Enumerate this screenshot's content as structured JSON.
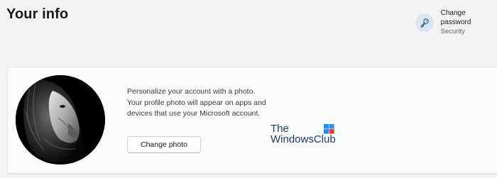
{
  "page": {
    "title": "Your info"
  },
  "related": {
    "title": "Change password",
    "subtitle": "Security",
    "icon": "key-icon"
  },
  "photo_card": {
    "avatar_icon": "lion-photo",
    "description": "Personalize your account with a photo. Your profile photo will appear on apps and devices that use your Microsoft account.",
    "button_label": "Change photo"
  },
  "watermark": {
    "line1": "The",
    "line2": "WindowsClub",
    "logo_colors": [
      "#1e90ff",
      "#e53935"
    ]
  },
  "colors": {
    "background": "#f3f3f3",
    "card": "#fbfbfb",
    "accent_circle": "#d8e6f3",
    "watermark_text": "#1c3a6b"
  }
}
